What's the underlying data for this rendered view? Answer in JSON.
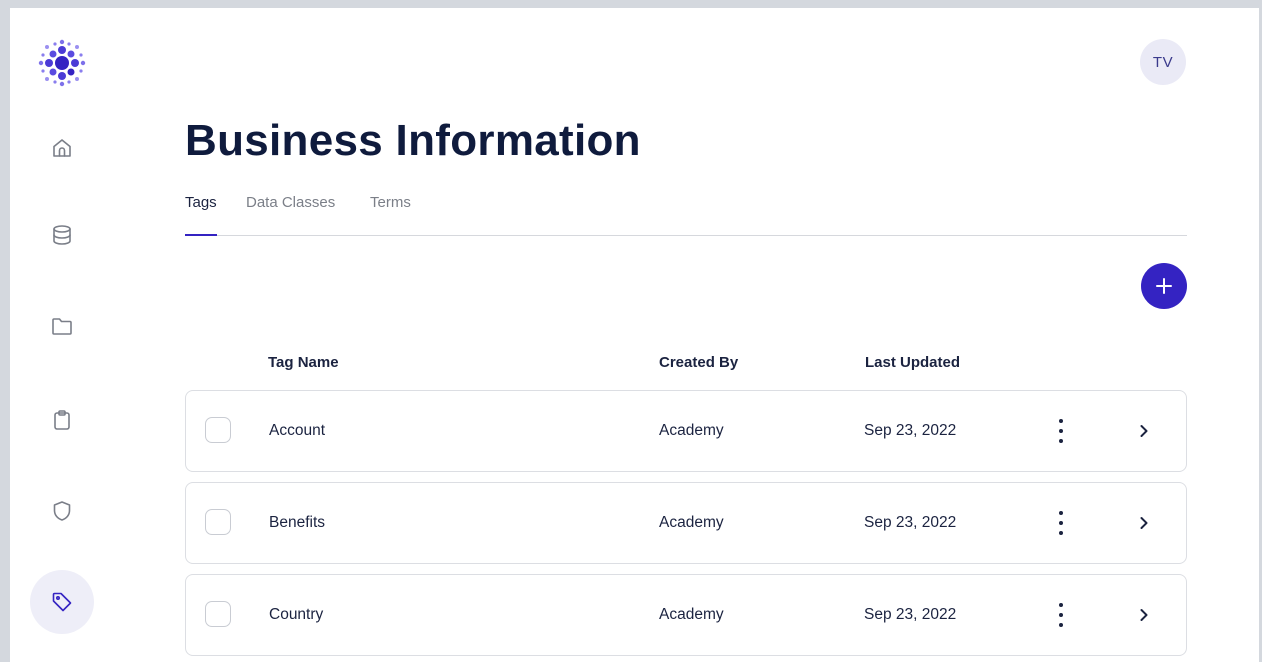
{
  "user": {
    "initials": "TV"
  },
  "sidebar": {
    "items": [
      {
        "icon": "home-icon",
        "active": false
      },
      {
        "icon": "database-icon",
        "active": false
      },
      {
        "icon": "folder-icon",
        "active": false
      },
      {
        "icon": "clipboard-icon",
        "active": false
      },
      {
        "icon": "shield-icon",
        "active": false
      },
      {
        "icon": "tag-icon",
        "active": true
      }
    ]
  },
  "page": {
    "title": "Business Information"
  },
  "tabs": [
    {
      "label": "Tags",
      "active": true
    },
    {
      "label": "Data Classes",
      "active": false
    },
    {
      "label": "Terms",
      "active": false
    }
  ],
  "table": {
    "columns": {
      "name": "Tag Name",
      "created_by": "Created By",
      "last_updated": "Last Updated"
    },
    "rows": [
      {
        "name": "Account",
        "created_by": "Academy",
        "last_updated": "Sep 23, 2022"
      },
      {
        "name": "Benefits",
        "created_by": "Academy",
        "last_updated": "Sep 23, 2022"
      },
      {
        "name": "Country",
        "created_by": "Academy",
        "last_updated": "Sep 23, 2022"
      }
    ]
  },
  "colors": {
    "accent": "#3423c2",
    "title": "#0f1b3d",
    "muted": "#7b7f88",
    "active_nav_bg": "#eeeef8"
  }
}
